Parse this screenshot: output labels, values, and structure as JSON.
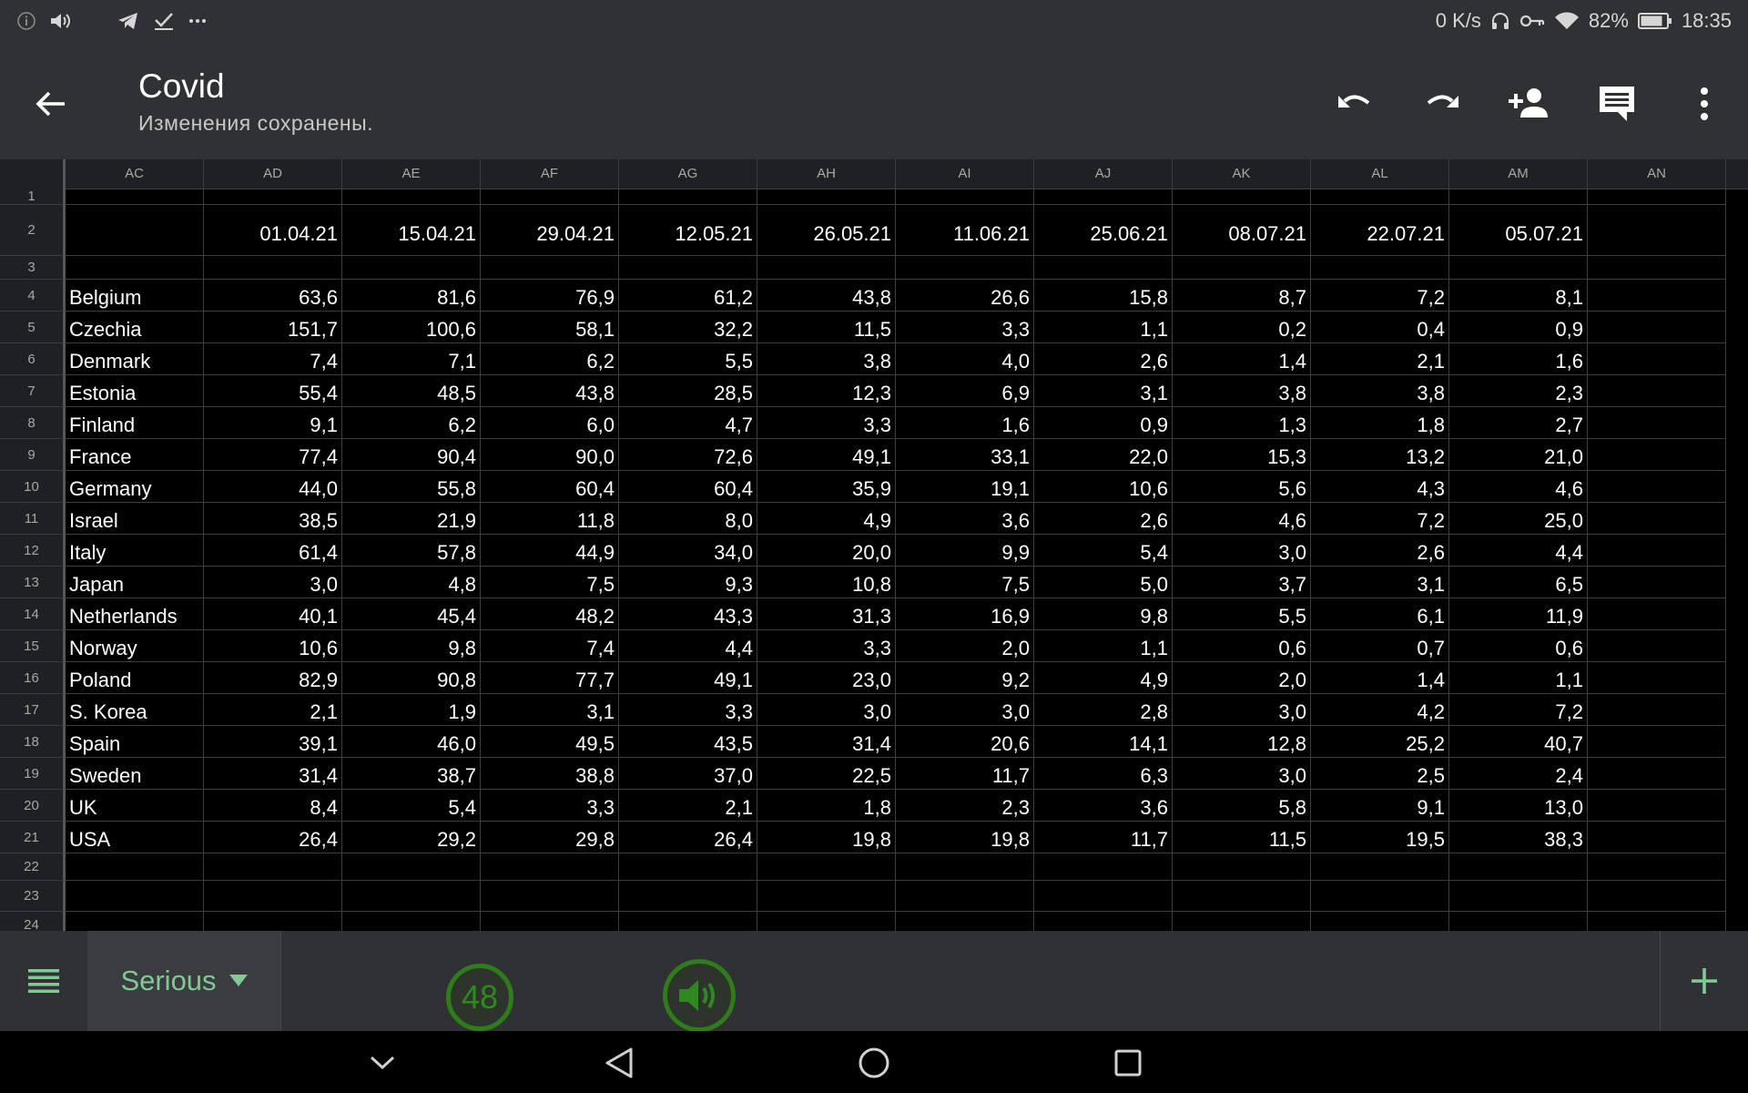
{
  "status_bar": {
    "net_speed": "0 K/s",
    "battery": "82%",
    "time": "18:35",
    "left_icons": [
      "info-icon",
      "volume-icon",
      "telegram-icon",
      "check-icon",
      "more-dots-icon"
    ],
    "right_icons": [
      "headphones-icon",
      "vpn-key-icon",
      "wifi-icon",
      "battery-icon"
    ]
  },
  "app_bar": {
    "title": "Covid",
    "subtitle": "Изменения сохранены.",
    "actions": [
      "undo-icon",
      "redo-icon",
      "share-person-add-icon",
      "comment-icon",
      "more-vert-icon"
    ]
  },
  "spreadsheet": {
    "columns": [
      "AC",
      "AD",
      "AE",
      "AF",
      "AG",
      "AH",
      "AI",
      "AJ",
      "AK",
      "AL",
      "AM",
      "AN"
    ],
    "row_numbers": [
      "1",
      "2",
      "3",
      "4",
      "5",
      "6",
      "7",
      "8",
      "9",
      "10",
      "11",
      "12",
      "13",
      "14",
      "15",
      "16",
      "17",
      "18",
      "19",
      "20",
      "21",
      "22",
      "23",
      "24"
    ],
    "dates": [
      "01.04.21",
      "15.04.21",
      "29.04.21",
      "12.05.21",
      "26.05.21",
      "11.06.21",
      "25.06.21",
      "08.07.21",
      "22.07.21",
      "05.07.21"
    ],
    "rows": [
      {
        "country": "Belgium",
        "values": [
          "63,6",
          "81,6",
          "76,9",
          "61,2",
          "43,8",
          "26,6",
          "15,8",
          "8,7",
          "7,2",
          "8,1"
        ]
      },
      {
        "country": "Czechia",
        "values": [
          "151,7",
          "100,6",
          "58,1",
          "32,2",
          "11,5",
          "3,3",
          "1,1",
          "0,2",
          "0,4",
          "0,9"
        ]
      },
      {
        "country": "Denmark",
        "values": [
          "7,4",
          "7,1",
          "6,2",
          "5,5",
          "3,8",
          "4,0",
          "2,6",
          "1,4",
          "2,1",
          "1,6"
        ]
      },
      {
        "country": "Estonia",
        "values": [
          "55,4",
          "48,5",
          "43,8",
          "28,5",
          "12,3",
          "6,9",
          "3,1",
          "3,8",
          "3,8",
          "2,3"
        ]
      },
      {
        "country": "Finland",
        "values": [
          "9,1",
          "6,2",
          "6,0",
          "4,7",
          "3,3",
          "1,6",
          "0,9",
          "1,3",
          "1,8",
          "2,7"
        ]
      },
      {
        "country": "France",
        "values": [
          "77,4",
          "90,4",
          "90,0",
          "72,6",
          "49,1",
          "33,1",
          "22,0",
          "15,3",
          "13,2",
          "21,0"
        ]
      },
      {
        "country": "Germany",
        "values": [
          "44,0",
          "55,8",
          "60,4",
          "60,4",
          "35,9",
          "19,1",
          "10,6",
          "5,6",
          "4,3",
          "4,6"
        ]
      },
      {
        "country": "Israel",
        "values": [
          "38,5",
          "21,9",
          "11,8",
          "8,0",
          "4,9",
          "3,6",
          "2,6",
          "4,6",
          "7,2",
          "25,0"
        ]
      },
      {
        "country": "Italy",
        "values": [
          "61,4",
          "57,8",
          "44,9",
          "34,0",
          "20,0",
          "9,9",
          "5,4",
          "3,0",
          "2,6",
          "4,4"
        ]
      },
      {
        "country": "Japan",
        "values": [
          "3,0",
          "4,8",
          "7,5",
          "9,3",
          "10,8",
          "7,5",
          "5,0",
          "3,7",
          "3,1",
          "6,5"
        ]
      },
      {
        "country": "Netherlands",
        "values": [
          "40,1",
          "45,4",
          "48,2",
          "43,3",
          "31,3",
          "16,9",
          "9,8",
          "5,5",
          "6,1",
          "11,9"
        ]
      },
      {
        "country": "Norway",
        "values": [
          "10,6",
          "9,8",
          "7,4",
          "4,4",
          "3,3",
          "2,0",
          "1,1",
          "0,6",
          "0,7",
          "0,6"
        ]
      },
      {
        "country": "Poland",
        "values": [
          "82,9",
          "90,8",
          "77,7",
          "49,1",
          "23,0",
          "9,2",
          "4,9",
          "2,0",
          "1,4",
          "1,1"
        ]
      },
      {
        "country": "S. Korea",
        "values": [
          "2,1",
          "1,9",
          "3,1",
          "3,3",
          "3,0",
          "3,0",
          "2,8",
          "3,0",
          "4,2",
          "7,2"
        ]
      },
      {
        "country": "Spain",
        "values": [
          "39,1",
          "46,0",
          "49,5",
          "43,5",
          "31,4",
          "20,6",
          "14,1",
          "12,8",
          "25,2",
          "40,7"
        ]
      },
      {
        "country": "Sweden",
        "values": [
          "31,4",
          "38,7",
          "38,8",
          "37,0",
          "22,5",
          "11,7",
          "6,3",
          "3,0",
          "2,5",
          "2,4"
        ]
      },
      {
        "country": "UK",
        "values": [
          "8,4",
          "5,4",
          "3,3",
          "2,1",
          "1,8",
          "2,3",
          "3,6",
          "5,8",
          "9,1",
          "13,0"
        ]
      },
      {
        "country": "USA",
        "values": [
          "26,4",
          "29,2",
          "29,8",
          "26,4",
          "19,8",
          "19,8",
          "11,7",
          "11,5",
          "19,5",
          "38,3"
        ]
      }
    ]
  },
  "sheet_bar": {
    "active_sheet": "Serious",
    "badge_count": "48"
  },
  "colors": {
    "chrome": "#303134",
    "grid_bg": "#000000",
    "accent_green": "#81c995",
    "overlay_green": "#2e7d1a"
  }
}
